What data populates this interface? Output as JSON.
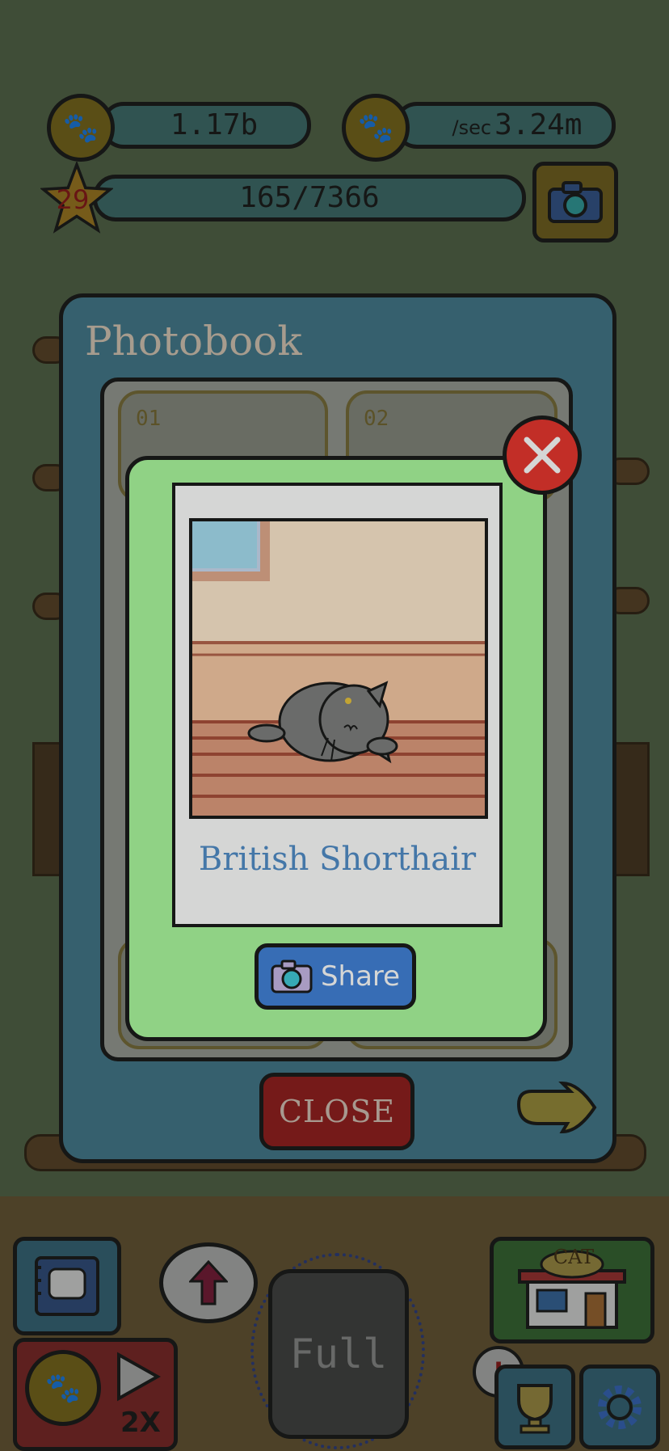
{
  "hud": {
    "coins": "1.17b",
    "rate_prefix": "/sec",
    "rate": "3.24m",
    "level": "29",
    "progress": "165/7366"
  },
  "photobook": {
    "title": "Photobook",
    "slots": [
      {
        "number": "01"
      },
      {
        "number": "02"
      }
    ],
    "close_label": "CLOSE"
  },
  "photo_dialog": {
    "cat_name": "British Shorthair",
    "share_label": "Share"
  },
  "toolbar": {
    "full_label": "Full",
    "boost_label": "2X",
    "shop_sign": "CAT",
    "alert_mark": "!"
  },
  "icons": {
    "coin": "paw-coin-icon",
    "camera": "camera-icon",
    "close": "close-x-icon",
    "next": "pointing-hand-icon",
    "photobook": "photobook-icon",
    "upgrade": "upgrade-arrow-icon",
    "shop": "cat-shop-icon",
    "trophy": "trophy-icon",
    "settings": "gear-icon"
  },
  "colors": {
    "dialog_bg": "#abfa9e",
    "panel_bg": "#3e7082",
    "close_red": "#e8322b",
    "cat_name_blue": "#4f8bc9"
  }
}
